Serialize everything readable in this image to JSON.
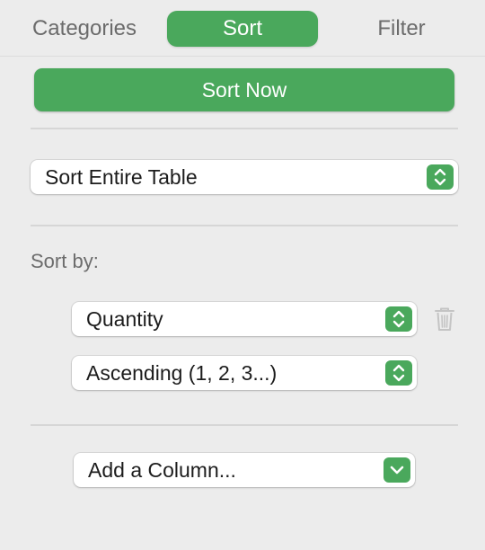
{
  "tabs": [
    {
      "label": "Categories",
      "active": false
    },
    {
      "label": "Sort",
      "active": true
    },
    {
      "label": "Filter",
      "active": false
    }
  ],
  "sort_now_label": "Sort Now",
  "scope_select": {
    "value": "Sort Entire Table"
  },
  "sort_by_label": "Sort by:",
  "column_select": {
    "value": "Quantity"
  },
  "order_select": {
    "value": "Ascending (1, 2, 3...)"
  },
  "add_column_select": {
    "value": "Add a Column..."
  },
  "colors": {
    "accent": "#4aa85c",
    "panel_bg": "#ececec"
  }
}
